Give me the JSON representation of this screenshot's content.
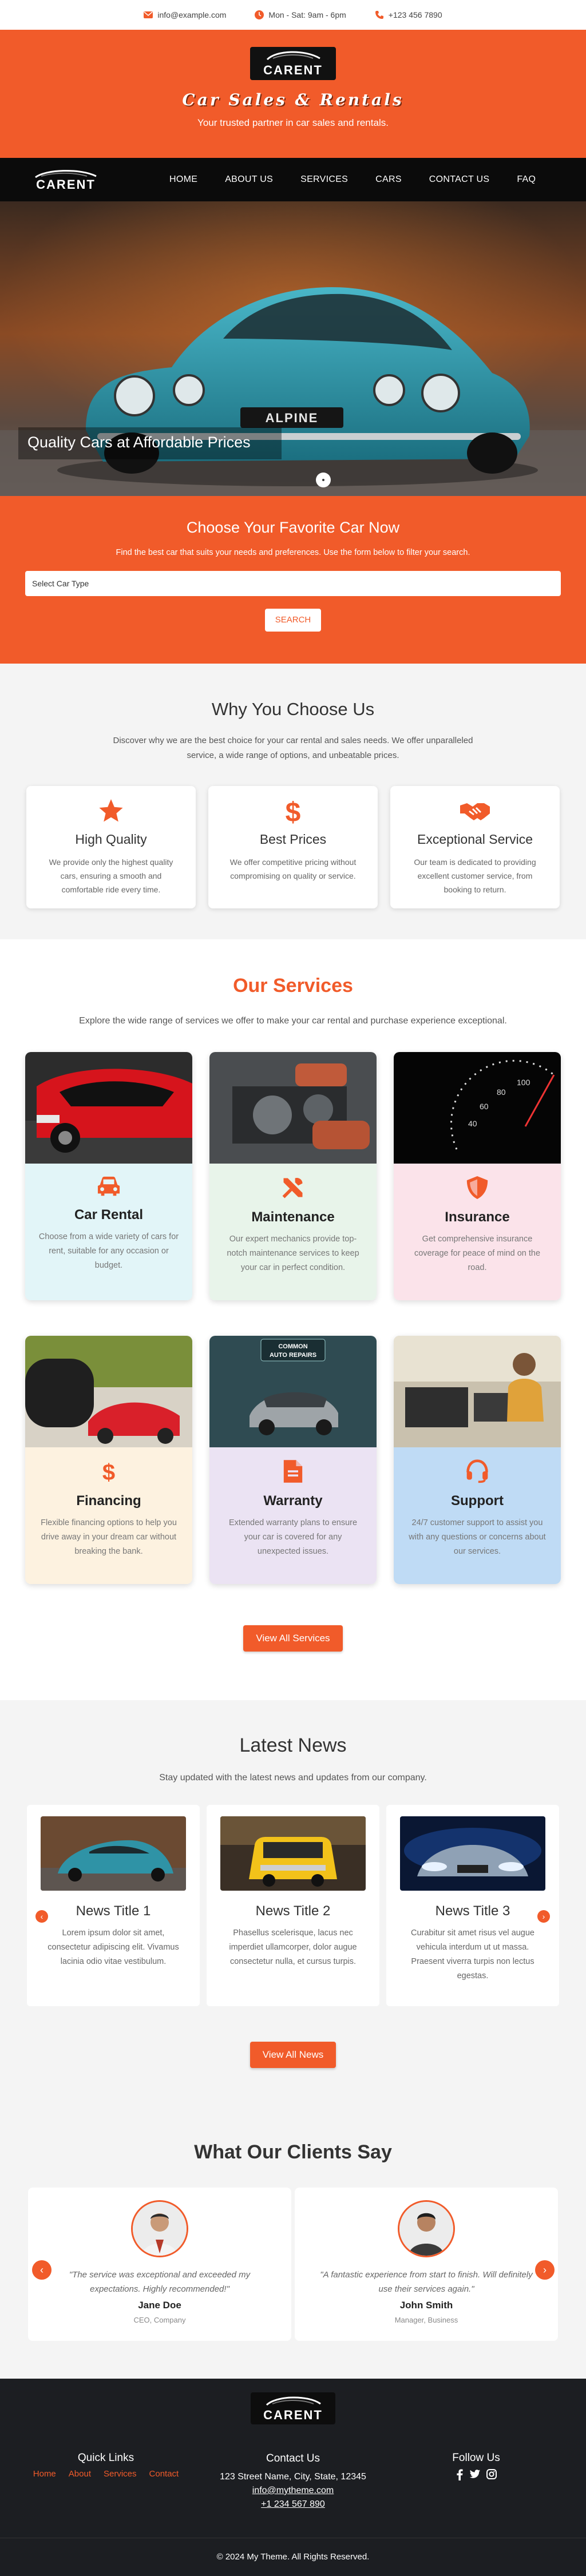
{
  "topbar": {
    "email": "info@example.com",
    "hours": "Mon - Sat: 9am - 6pm",
    "phone": "+123 456 7890"
  },
  "brand": {
    "logo_text": "CARENT",
    "title": "Car Sales & Rentals",
    "subtitle": "Your trusted partner in car sales and rentals."
  },
  "nav": {
    "items": [
      "HOME",
      "ABOUT US",
      "SERVICES",
      "CARS",
      "CONTACT US",
      "FAQ"
    ]
  },
  "hero": {
    "caption": "Quality Cars at Affordable Prices",
    "plate": "ALPINE"
  },
  "choose": {
    "title": "Choose Your Favorite Car Now",
    "subtitle": "Find the best car that suits your needs and preferences. Use the form below to filter your search.",
    "select_value": "Select Car Type",
    "button": "SEARCH"
  },
  "why": {
    "title": "Why You Choose Us",
    "intro": "Discover why we are the best choice for your car rental and sales needs. We offer unparalleled service, a wide range of options, and unbeatable prices.",
    "cards": [
      {
        "icon": "star-icon",
        "title": "High Quality",
        "text": "We provide only the highest quality cars, ensuring a smooth and comfortable ride every time."
      },
      {
        "icon": "dollar-icon",
        "title": "Best Prices",
        "text": "We offer competitive pricing without compromising on quality or service."
      },
      {
        "icon": "handshake-icon",
        "title": "Exceptional Service",
        "text": "Our team is dedicated to providing excellent customer service, from booking to return."
      }
    ]
  },
  "services": {
    "title": "Our Services",
    "intro": "Explore the wide range of services we offer to make your car rental and purchase experience exceptional.",
    "items": [
      {
        "icon": "car-icon",
        "title": "Car Rental",
        "text": "Choose from a wide variety of cars for rent, suitable for any occasion or budget."
      },
      {
        "icon": "tools-icon",
        "title": "Maintenance",
        "text": "Our expert mechanics provide top-notch maintenance services to keep your car in perfect condition."
      },
      {
        "icon": "shield-icon",
        "title": "Insurance",
        "text": "Get comprehensive insurance coverage for peace of mind on the road."
      },
      {
        "icon": "dollar-icon",
        "title": "Financing",
        "text": "Flexible financing options to help you drive away in your dream car without breaking the bank."
      },
      {
        "icon": "document-icon",
        "title": "Warranty",
        "text": "Extended warranty plans to ensure your car is covered for any unexpected issues."
      },
      {
        "icon": "headset-icon",
        "title": "Support",
        "text": "24/7 customer support to assist you with any questions or concerns about our services."
      }
    ],
    "warranty_banner": [
      "COMMON",
      "AUTO REPAIRS"
    ],
    "button": "View All Services"
  },
  "news": {
    "title": "Latest News",
    "intro": "Stay updated with the latest news and updates from our company.",
    "items": [
      {
        "title": "News Title 1",
        "text": "Lorem ipsum dolor sit amet, consectetur adipiscing elit. Vivamus lacinia odio vitae vestibulum."
      },
      {
        "title": "News Title 2",
        "text": "Phasellus scelerisque, lacus nec imperdiet ullamcorper, dolor augue consectetur nulla, et cursus turpis."
      },
      {
        "title": "News Title 3",
        "text": "Curabitur sit amet risus vel augue vehicula interdum ut ut massa. Praesent viverra turpis non lectus egestas."
      }
    ],
    "button": "View All News"
  },
  "testimonials": {
    "title": "What Our Clients Say",
    "items": [
      {
        "quote": "\"The service was exceptional and exceeded my expectations. Highly recommended!\"",
        "name": "Jane Doe",
        "role": "CEO, Company"
      },
      {
        "quote": "\"A fantastic experience from start to finish. Will definitely use their services again.\"",
        "name": "John Smith",
        "role": "Manager, Business"
      }
    ]
  },
  "footer": {
    "logo_text": "CARENT",
    "quick_links_title": "Quick Links",
    "links": [
      "Home",
      "About",
      "Services",
      "Contact"
    ],
    "contact_title": "Contact Us",
    "address": "123 Street Name, City, State, 12345",
    "email": "info@mytheme.com",
    "phone": "+1 234 567 890",
    "follow_title": "Follow Us",
    "socials": [
      "facebook-icon",
      "twitter-icon",
      "instagram-icon"
    ],
    "copyright": "© 2024 My Theme. All Rights Reserved."
  },
  "colors": {
    "accent": "#f15b2a",
    "nav_bg": "#0b0b0b",
    "footer_bg": "#1c1e22",
    "section_gray": "#f4f4f4"
  }
}
